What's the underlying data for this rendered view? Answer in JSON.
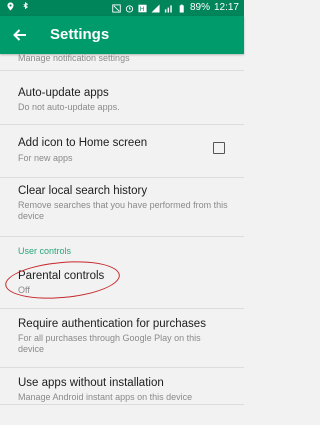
{
  "status_bar": {
    "battery_percent": "89%",
    "time": "12:17"
  },
  "app_bar": {
    "title": "Settings"
  },
  "items": [
    {
      "title": "",
      "subtitle": "Manage notification settings"
    },
    {
      "title": "Auto-update apps",
      "subtitle": "Do not auto-update apps."
    },
    {
      "title": "Add icon to Home screen",
      "subtitle": "For new apps",
      "checked": false
    },
    {
      "title": "Clear local search history",
      "subtitle": "Remove searches that you have performed from this device"
    },
    {
      "title": "Parental controls",
      "subtitle": "Off"
    },
    {
      "title": "Require authentication for purchases",
      "subtitle": "For all purchases through Google Play on this device"
    },
    {
      "title": "Use apps without installation",
      "subtitle": "Manage Android instant apps on this device"
    }
  ],
  "section_header": "User controls",
  "colors": {
    "status_bar": "#00845a",
    "app_bar": "#009b6a",
    "section_header": "#2aa67b",
    "annotation": "#c7262b"
  }
}
